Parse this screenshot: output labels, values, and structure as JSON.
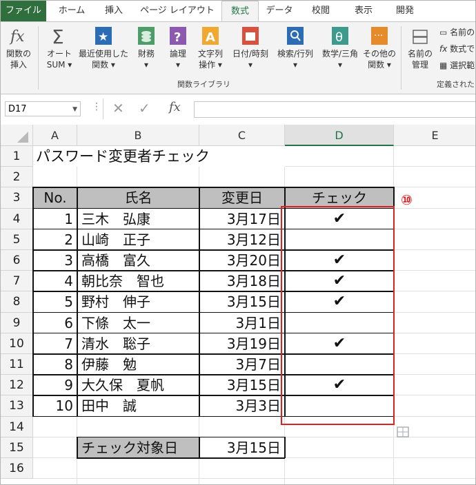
{
  "ribbon_tabs": [
    "ファイル",
    "ホーム",
    "挿入",
    "ページ レイアウト",
    "数式",
    "データ",
    "校閲",
    "表示",
    "開発"
  ],
  "ribbon_buttons": {
    "insert_function": [
      "関数の",
      "挿入"
    ],
    "autosum": [
      "オート",
      "SUM ▾"
    ],
    "recent": [
      "最近使用した",
      "関数 ▾"
    ],
    "financial": [
      "財務",
      "▾"
    ],
    "logical": [
      "論理",
      "▾"
    ],
    "text": [
      "文字列",
      "操作 ▾"
    ],
    "datetime": [
      "日付/時刻",
      "▾"
    ],
    "lookup": [
      "検索/行列",
      "▾"
    ],
    "math": [
      "数学/三角",
      "▾"
    ],
    "other": [
      "その他の",
      "関数 ▾"
    ],
    "name_manager": [
      "名前の",
      "管理"
    ],
    "define_name": "名前の",
    "use_in_formula": "数式で",
    "create_from_selection": "選択範"
  },
  "group_labels": {
    "function_library": "関数ライブラリ",
    "defined_names": "定義された"
  },
  "formula_bar": {
    "name_box": "D17",
    "formula": ""
  },
  "columns": [
    "A",
    "B",
    "C",
    "D",
    "E"
  ],
  "rows": [
    "1",
    "2",
    "3",
    "4",
    "5",
    "6",
    "7",
    "8",
    "9",
    "10",
    "11",
    "12",
    "13",
    "14",
    "15",
    "16"
  ],
  "title": "パスワード変更者チェック",
  "table_headers": {
    "no": "No.",
    "name": "氏名",
    "date": "変更日",
    "check": "チェック"
  },
  "records": [
    {
      "no": "1",
      "name": "三木　弘康",
      "date": "3月17日",
      "check": "✔"
    },
    {
      "no": "2",
      "name": "山崎　正子",
      "date": "3月12日",
      "check": ""
    },
    {
      "no": "3",
      "name": "高橋　富久",
      "date": "3月20日",
      "check": "✔"
    },
    {
      "no": "4",
      "name": "朝比奈　智也",
      "date": "3月18日",
      "check": "✔"
    },
    {
      "no": "5",
      "name": "野村　伸子",
      "date": "3月15日",
      "check": "✔"
    },
    {
      "no": "6",
      "name": "下條　太一",
      "date": "3月1日",
      "check": ""
    },
    {
      "no": "7",
      "name": "清水　聡子",
      "date": "3月19日",
      "check": "✔"
    },
    {
      "no": "8",
      "name": "伊藤　勉",
      "date": "3月7日",
      "check": ""
    },
    {
      "no": "9",
      "name": "大久保　夏帆",
      "date": "3月15日",
      "check": "✔"
    },
    {
      "no": "10",
      "name": "田中　誠",
      "date": "3月3日",
      "check": ""
    }
  ],
  "target": {
    "label": "チェック対象日",
    "value": "3月15日"
  },
  "annotation": "⑩",
  "colors": {
    "accent": "#217346",
    "highlight": "#e02020",
    "header_fill": "#bfbfbf"
  }
}
